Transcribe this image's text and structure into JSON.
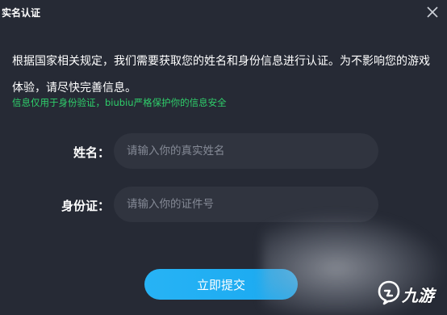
{
  "dialog": {
    "title": "实名认证",
    "description": "根据国家相关规定，我们需要获取您的姓名和身份信息进行认证。为不影响您的游戏体验，请尽快完善信息。",
    "notice": "信息仅用于身份验证，biubiu严格保护你的信息安全",
    "notice_color": "#2fd06b"
  },
  "form": {
    "name_label": "姓名：",
    "name_placeholder": "请输入你的真实姓名",
    "id_label": "身份证：",
    "id_placeholder": "请输入你的证件号",
    "submit_label": "立即提交"
  },
  "watermark": {
    "text": "九游",
    "icon": "jiuyou-logo-icon"
  },
  "colors": {
    "background": "#262a35",
    "input_background": "#30343f",
    "accent": "#1aa9f0"
  }
}
